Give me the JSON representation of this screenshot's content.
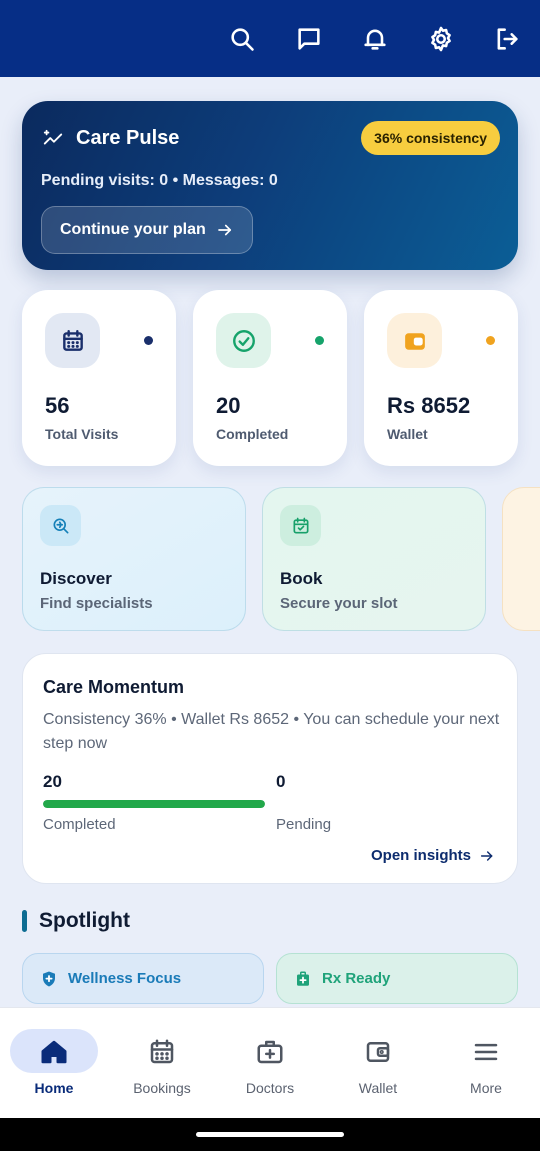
{
  "header": {
    "icons": [
      "search-icon",
      "message-icon",
      "bell-icon",
      "gear-icon",
      "logout-icon"
    ],
    "background": "#062e86"
  },
  "pulse": {
    "title": "Care Pulse",
    "badge": "36% consistency",
    "subtitle": "Pending visits: 0 • Messages: 0",
    "cta": "Continue your plan"
  },
  "stats": [
    {
      "value": "56",
      "label": "Total Visits",
      "icon": "calendar-icon",
      "color": "#1a2f6b",
      "dot": "#1a2f6b"
    },
    {
      "value": "20",
      "label": "Completed",
      "icon": "check-circle-icon",
      "color": "#16a36b",
      "dot": "#16a36b"
    },
    {
      "value": "Rs 8652",
      "label": "Wallet",
      "icon": "wallet-icon",
      "color": "#f0a31f",
      "dot": "#f0a31f"
    }
  ],
  "quick_actions": [
    {
      "title": "Discover",
      "subtitle": "Find specialists",
      "icon": "search-globe-icon"
    },
    {
      "title": "Book",
      "subtitle": "Secure your slot",
      "icon": "calendar-check-icon"
    }
  ],
  "momentum": {
    "title": "Care Momentum",
    "description": "Consistency 36% • Wallet Rs 8652 • You can schedule your next step now",
    "completed_value": "20",
    "completed_label": "Completed",
    "completed_fraction": 1.0,
    "pending_value": "0",
    "pending_label": "Pending",
    "link": "Open insights"
  },
  "spotlight": {
    "title": "Spotlight",
    "chips": [
      {
        "label": "Wellness Focus",
        "icon": "shield-icon",
        "color": "#1a7bb8"
      },
      {
        "label": "Rx Ready",
        "icon": "medical-bag-icon",
        "color": "#1fa37a"
      }
    ]
  },
  "nav": {
    "items": [
      {
        "label": "Home",
        "icon": "home-icon",
        "active": true
      },
      {
        "label": "Bookings",
        "icon": "calendar-grid-icon",
        "active": false
      },
      {
        "label": "Doctors",
        "icon": "medical-kit-icon",
        "active": false
      },
      {
        "label": "Wallet",
        "icon": "wallet-icon",
        "active": false
      },
      {
        "label": "More",
        "icon": "menu-icon",
        "active": false
      }
    ]
  }
}
